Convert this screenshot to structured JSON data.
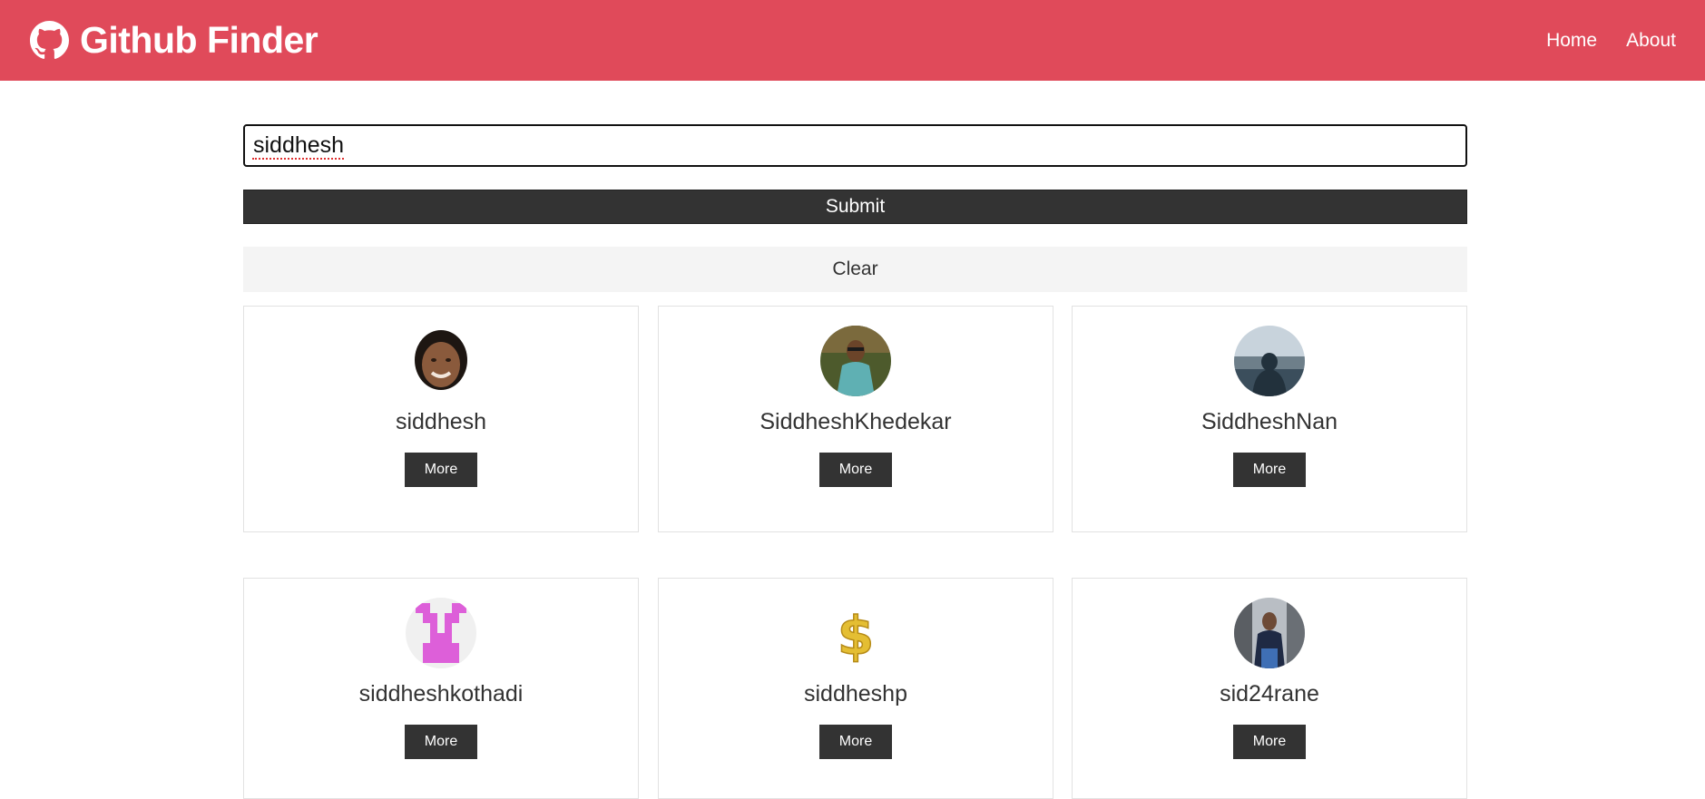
{
  "navbar": {
    "brand_icon": "github-icon",
    "title": "Github Finder",
    "links": [
      "Home",
      "About"
    ]
  },
  "search": {
    "value": "siddhesh",
    "submit_label": "Submit",
    "clear_label": "Clear"
  },
  "users": [
    {
      "login": "siddhesh",
      "more_label": "More",
      "avatar": "face-photo"
    },
    {
      "login": "SiddheshKhedekar",
      "more_label": "More",
      "avatar": "outdoor-photo"
    },
    {
      "login": "SiddheshNan",
      "more_label": "More",
      "avatar": "lake-photo"
    },
    {
      "login": "siddheshkothadi",
      "more_label": "More",
      "avatar": "identicon"
    },
    {
      "login": "siddheshp",
      "more_label": "More",
      "avatar": "dollar-sign"
    },
    {
      "login": "sid24rane",
      "more_label": "More",
      "avatar": "outdoor-photo"
    }
  ],
  "colors": {
    "navbar": "#e04a5a",
    "dark": "#333333",
    "light": "#f4f4f4"
  }
}
